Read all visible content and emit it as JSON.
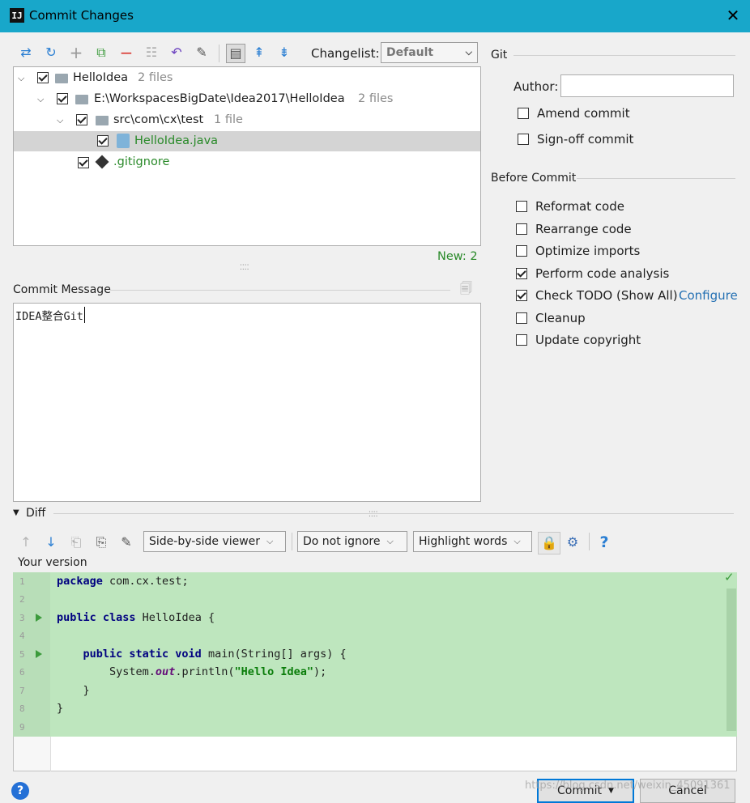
{
  "window": {
    "title": "Commit Changes",
    "app_icon_text": "IJ"
  },
  "toolbar": {
    "icons": [
      "show-diff-icon",
      "refresh-icon",
      "add-icon",
      "move-to-changelist-icon",
      "remove-icon",
      "group-by-icon",
      "rollback-icon",
      "edit-source-icon",
      "toggle-view-icon",
      "expand-all-icon",
      "collapse-all-icon"
    ],
    "changelist_label": "Changelist:",
    "changelist_value": "Default"
  },
  "tree": {
    "root": {
      "name": "HelloIdea",
      "count": "2 files"
    },
    "path": {
      "name": "E:\\WorkspacesBigDate\\Idea2017\\HelloIdea",
      "count": "2 files"
    },
    "package": {
      "name": "src\\com\\cx\\test",
      "count": "1 file"
    },
    "file1": {
      "name": "HelloIdea.java"
    },
    "file2": {
      "name": ".gitignore"
    },
    "status": "New: 2"
  },
  "commit_message": {
    "label": "Commit Message",
    "value": "IDEA整合Git"
  },
  "git": {
    "section": "Git",
    "author_label": "Author:",
    "author_value": "",
    "amend": "Amend commit",
    "signoff": "Sign-off commit"
  },
  "before_commit": {
    "section": "Before Commit",
    "options": [
      {
        "label": "Reformat code",
        "checked": false
      },
      {
        "label": "Rearrange code",
        "checked": false
      },
      {
        "label": "Optimize imports",
        "checked": false
      },
      {
        "label": "Perform code analysis",
        "checked": true
      },
      {
        "label": "Check TODO (Show All)",
        "checked": true
      },
      {
        "label": "Cleanup",
        "checked": false
      },
      {
        "label": "Update copyright",
        "checked": false
      }
    ],
    "configure": "Configure"
  },
  "diff": {
    "label": "Diff",
    "viewer": "Side-by-side viewer",
    "whitespace": "Do not ignore",
    "highlight": "Highlight words",
    "help": "?",
    "your_version": "Your version",
    "lines": [
      "1",
      "2",
      "3",
      "4",
      "5",
      "6",
      "7",
      "8",
      "9"
    ]
  },
  "footer": {
    "commit": "Commit",
    "cancel": "Cancel",
    "help": "?",
    "watermark": "https://blog.csdn.net/weixin_45091361"
  },
  "colors": {
    "titlebar": "#18a7ca",
    "added_bg": "#bee6be",
    "green_text": "#2a8a2a",
    "link": "#2470b3"
  }
}
